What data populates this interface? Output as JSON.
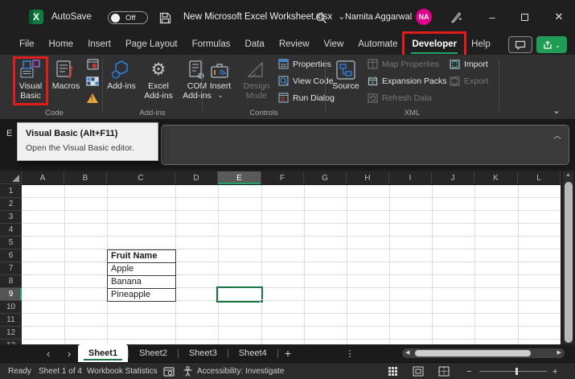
{
  "title_bar": {
    "autosave_label": "AutoSave",
    "autosave_state": "Off",
    "document_title": "New Microsoft Excel Worksheet.xlsx",
    "user_name": "Namita Aggarwal",
    "user_initials": "NA",
    "app_letter": "X"
  },
  "ribbon_tabs": {
    "items": [
      {
        "label": "File"
      },
      {
        "label": "Home"
      },
      {
        "label": "Insert"
      },
      {
        "label": "Page Layout"
      },
      {
        "label": "Formulas"
      },
      {
        "label": "Data"
      },
      {
        "label": "Review"
      },
      {
        "label": "View"
      },
      {
        "label": "Automate"
      },
      {
        "label": "Developer",
        "active": true,
        "highlighted": true
      },
      {
        "label": "Help"
      }
    ]
  },
  "ribbon": {
    "code_group": {
      "label": "Code",
      "visual_basic": "Visual Basic",
      "macros": "Macros"
    },
    "addins_group": {
      "label": "Add-ins",
      "addins": "Add-ins",
      "excel_addins": "Excel Add-ins",
      "com_addins": "COM Add-ins"
    },
    "controls_group": {
      "label": "Controls",
      "insert": "Insert",
      "design_mode": "Design Mode",
      "properties": "Properties",
      "view_code": "View Code",
      "run_dialog": "Run Dialog"
    },
    "xml_group": {
      "label": "XML",
      "source": "Source",
      "map_properties": "Map Properties",
      "expansion_packs": "Expansion Packs",
      "refresh_data": "Refresh Data",
      "import": "Import",
      "export": "Export"
    }
  },
  "tooltip": {
    "title": "Visual Basic (Alt+F11)",
    "body": "Open the Visual Basic editor."
  },
  "formula_bar": {
    "name_box": "E"
  },
  "grid": {
    "columns": [
      "A",
      "B",
      "C",
      "D",
      "E",
      "F",
      "G",
      "H",
      "I",
      "J",
      "K",
      "L"
    ],
    "selected_column": "E",
    "row_count": 13,
    "selected_row": 9,
    "active_cell": "E9",
    "cells": [
      {
        "ref": "C6",
        "text": "Fruit Name",
        "bold": true
      },
      {
        "ref": "C7",
        "text": "Apple"
      },
      {
        "ref": "C8",
        "text": "Banana"
      },
      {
        "ref": "C9",
        "text": "Pineapple"
      }
    ]
  },
  "sheet_bar": {
    "tabs": [
      "Sheet1",
      "Sheet2",
      "Sheet3",
      "Sheet4"
    ],
    "active_tab": "Sheet1"
  },
  "status_bar": {
    "mode": "Ready",
    "sheet_info": "Sheet 1 of 4",
    "workbook_statistics": "Workbook Statistics",
    "accessibility": "Accessibility: Investigate"
  },
  "glyphs": {
    "chevron_down": "⌄",
    "chevron_up": "︿",
    "minimize": "–",
    "close": "✕",
    "gear": "⚙",
    "left_arrow": "‹",
    "right_arrow": "›",
    "plus": "+",
    "kebab": "⋮",
    "scroll_left": "◀",
    "scroll_right": "▶",
    "up_small": "▲",
    "zoom_out": "−",
    "zoom_in": "+"
  },
  "colors": {
    "accent_green": "#21a366",
    "selection_green": "#107c41",
    "highlight_red": "#e01e1e",
    "avatar_pink": "#e3008c",
    "share_green": "#1f9d55"
  }
}
